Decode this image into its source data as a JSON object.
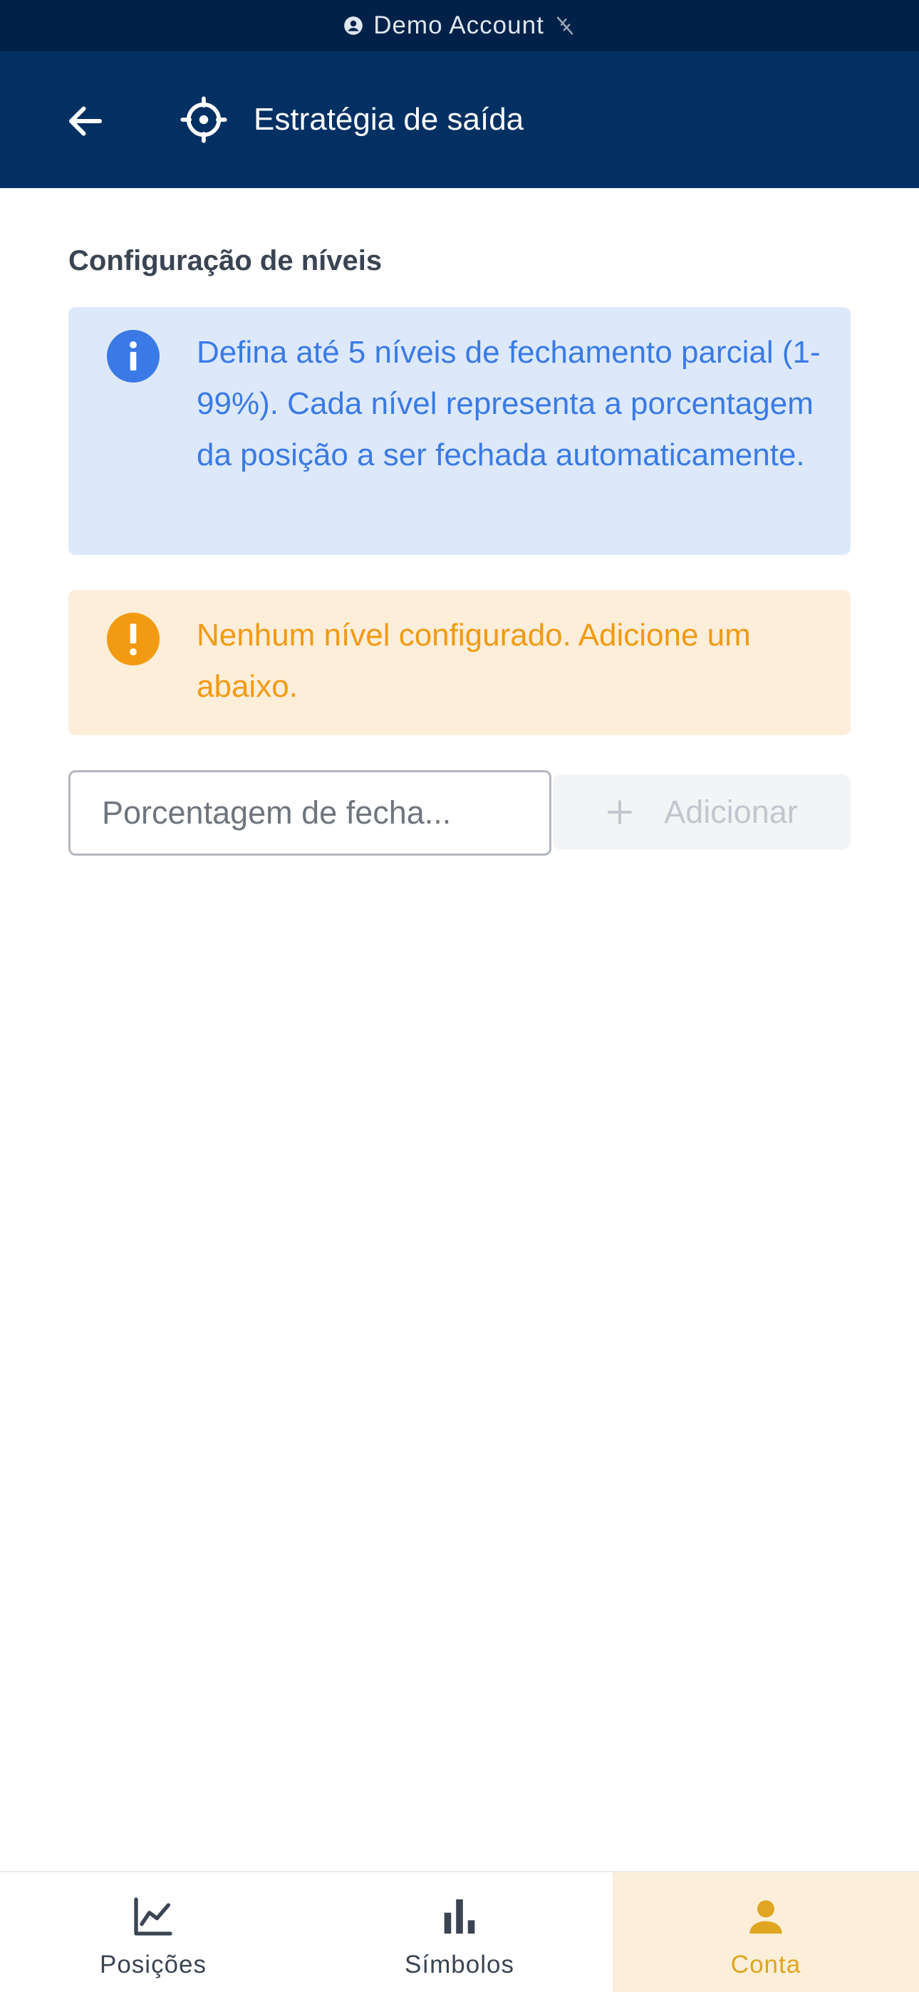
{
  "account_bar": {
    "label": "Demo Account",
    "icons": [
      "account-circle-icon",
      "wifi-off-icon"
    ]
  },
  "header": {
    "title": "Estratégia de saída",
    "icons": [
      "back-arrow-icon",
      "target-crosshair-icon"
    ]
  },
  "content": {
    "section_title": "Configuração de níveis",
    "info": "Defina até 5 níveis de fechamento parcial (1-99%). Cada nível representa a porcentagem da posição a ser fechada automaticamente.",
    "warning": "Nenhum nível configurado. Adicione um abaixo.",
    "input": {
      "placeholder": "Porcentagem de fecha...",
      "value": ""
    },
    "add_button": "Adicionar"
  },
  "bottom_nav": {
    "items": [
      {
        "label": "Posições",
        "icon": "line-chart-icon",
        "active": false
      },
      {
        "label": "Símbolos",
        "icon": "bar-chart-icon",
        "active": false
      },
      {
        "label": "Conta",
        "icon": "person-icon",
        "active": true
      }
    ]
  },
  "colors": {
    "header_bg": "#023063",
    "status_bg": "#022148",
    "info_bg": "#dde9fb",
    "info_text": "#3b7ae6",
    "warning_bg": "#fdeeda",
    "warning_text": "#f29a11",
    "active_nav_bg": "#fbefd9",
    "active_nav_text": "#e0a521"
  }
}
